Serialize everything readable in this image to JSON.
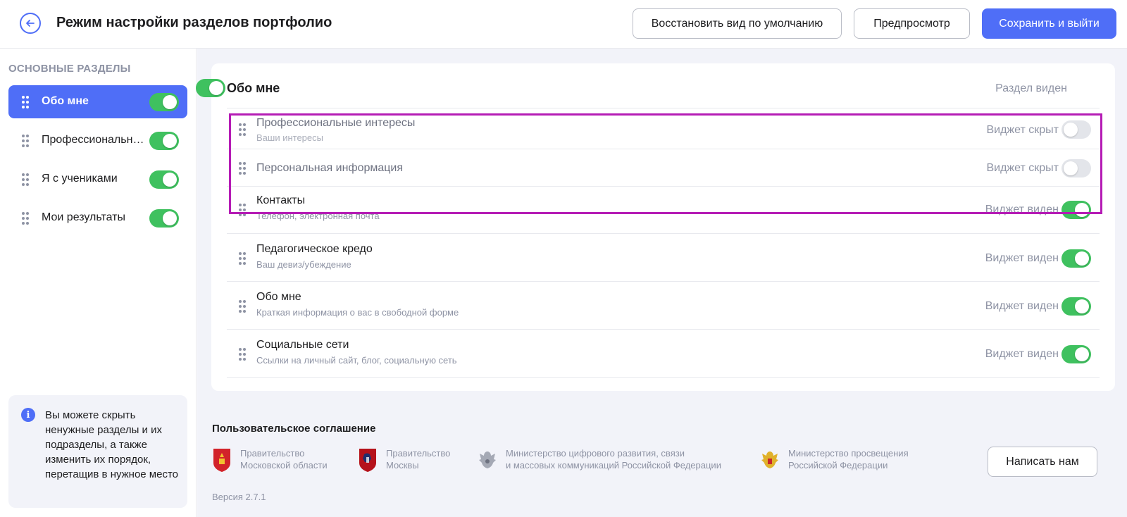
{
  "header": {
    "title": "Режим настройки разделов портфолио",
    "restore_label": "Восстановить вид по умолчанию",
    "preview_label": "Предпросмотр",
    "save_label": "Сохранить и выйти"
  },
  "sidebar": {
    "heading": "Основные разделы",
    "items": [
      {
        "label": "Обо мне",
        "active": true,
        "visible": true
      },
      {
        "label": "Профессиональные интересы",
        "active": false,
        "visible": true
      },
      {
        "label": "Я с учениками",
        "active": false,
        "visible": true
      },
      {
        "label": "Мои результаты",
        "active": false,
        "visible": true
      }
    ],
    "info_text": "Вы можете скрыть ненужные разделы и их подразделы, а также изменить их порядок, перетащив в нужное место"
  },
  "section": {
    "title": "Обо мне",
    "status": "Раздел виден",
    "visible": true,
    "widgets": [
      {
        "title": "Профессиональные интересы",
        "subtitle": "Ваши интересы",
        "status": "Виджет скрыт",
        "visible": false
      },
      {
        "title": "Персональная информация",
        "subtitle": "",
        "status": "Виджет скрыт",
        "visible": false
      },
      {
        "title": "Контакты",
        "subtitle": "Телефон, электронная почта",
        "status": "Виджет виден",
        "visible": true
      },
      {
        "title": "Педагогическое кредо",
        "subtitle": "Ваш девиз/убеждение",
        "status": "Виджет виден",
        "visible": true
      },
      {
        "title": "Обо мне",
        "subtitle": "Краткая информация о вас в свободной форме",
        "status": "Виджет виден",
        "visible": true
      },
      {
        "title": "Социальные сети",
        "subtitle": "Ссылки на личный сайт, блог, социальную сеть",
        "status": "Виджет виден",
        "visible": true
      }
    ]
  },
  "footer": {
    "agreement": "Пользовательское соглашение",
    "orgs": [
      {
        "line1": "Правительство",
        "line2": "Московской области"
      },
      {
        "line1": "Правительство",
        "line2": "Москвы"
      },
      {
        "line1": "Министерство цифрового развития, связи",
        "line2": "и массовых коммуникаций Российской Федерации"
      },
      {
        "line1": "Министерство просвещения",
        "line2": "Российской Федерации"
      }
    ],
    "write_label": "Написать нам",
    "version": "Версия 2.7.1"
  },
  "colors": {
    "accent": "#4f6ef7",
    "toggle_on": "#3fc15f",
    "toggle_off": "#e3e5ea",
    "highlight": "#b51cb5"
  }
}
